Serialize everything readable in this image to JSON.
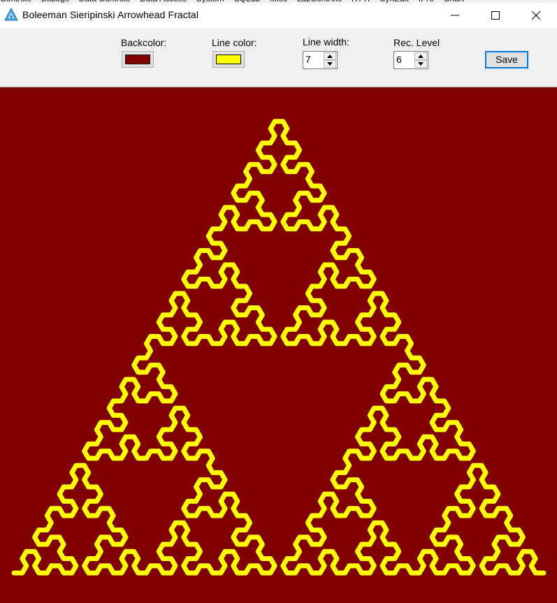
{
  "background_strip": [
    "Controls",
    "Dialogs",
    "Data Controls",
    "Data Access",
    "System",
    "SQLdb",
    "Misc",
    "LazControls",
    "RTTI",
    "SynEdit",
    "IPro",
    "Chart"
  ],
  "window": {
    "title": "Boleeman Sieripinski Arrowhead Fractal",
    "icon": "triangle-app-icon",
    "controls": [
      "minimize-icon",
      "maximize-icon",
      "close-icon"
    ]
  },
  "toolbar": {
    "backcolor_label": "Backcolor:",
    "backcolor_value": "#800000",
    "linecolor_label": "Line color:",
    "linecolor_value": "#ffff00",
    "linewidth_label": "Line width:",
    "linewidth_value": "7",
    "reclevel_label": "Rec. Level",
    "reclevel_value": "6",
    "save_label": "Save"
  },
  "fractal": {
    "type": "sierpinski-arrowhead",
    "recursion_level": 6,
    "line_width": 7,
    "background_color": "#800000",
    "line_color": "#ffff00"
  },
  "colors": {
    "accent": "#0078d7",
    "titlebar": "#ffffff",
    "toolbar": "#f0f0f0"
  }
}
